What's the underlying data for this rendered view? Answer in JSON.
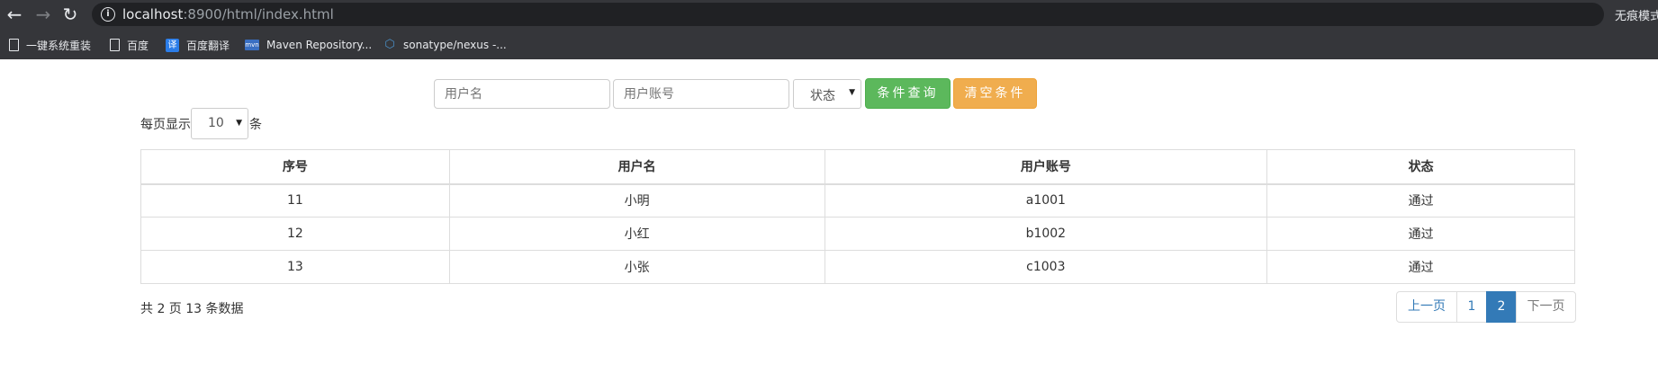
{
  "browser": {
    "url_host": "localhost",
    "url_rest": ":8900/html/index.html",
    "incognito_label": "无痕模式",
    "bookmarks": [
      {
        "label": "一键系统重装",
        "icon": "page-icon"
      },
      {
        "label": "百度",
        "icon": "page-icon"
      },
      {
        "label": "百度翻译",
        "icon": "translate-icon",
        "glyph": "译"
      },
      {
        "label": "Maven Repository...",
        "icon": "maven-icon",
        "glyph": "mvn"
      },
      {
        "label": "sonatype/nexus -...",
        "icon": "nexus-icon",
        "glyph": "⬡"
      }
    ]
  },
  "search": {
    "username_placeholder": "用户名",
    "account_placeholder": "用户账号",
    "status_selected": "状态",
    "query_button": "条件查询",
    "clear_button": "清空条件"
  },
  "page_size": {
    "prefix": "每页显示",
    "value": "10",
    "suffix": "条"
  },
  "table": {
    "headers": [
      "序号",
      "用户名",
      "用户账号",
      "状态"
    ],
    "rows": [
      [
        "11",
        "小明",
        "a1001",
        "通过"
      ],
      [
        "12",
        "小红",
        "b1002",
        "通过"
      ],
      [
        "13",
        "小张",
        "c1003",
        "通过"
      ]
    ]
  },
  "summary": "共 2 页 13 条数据",
  "pagination": {
    "prev": "上一页",
    "pages": [
      "1",
      "2"
    ],
    "current": "2",
    "next": "下一页"
  },
  "colors": {
    "success": "#5cb85c",
    "warning": "#f0ad4e",
    "primary": "#337ab7",
    "chrome_bg": "#35363a"
  }
}
